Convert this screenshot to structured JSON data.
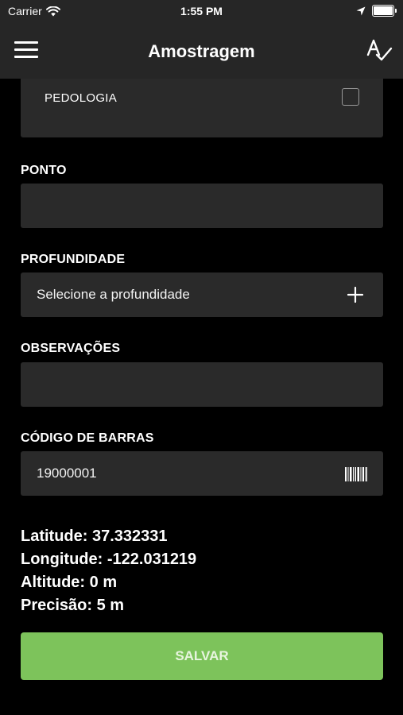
{
  "status_bar": {
    "carrier": "Carrier",
    "time": "1:55 PM"
  },
  "nav": {
    "title": "Amostragem",
    "menu_icon": "menu-icon",
    "right_icon": "spellcheck-icon"
  },
  "form": {
    "category": {
      "label": "PEDOLOGIA",
      "checked": false
    },
    "ponto": {
      "label": "PONTO",
      "value": ""
    },
    "profundidade": {
      "label": "PROFUNDIDADE",
      "placeholder": "Selecione a profundidade",
      "icon": "plus-icon"
    },
    "observacoes": {
      "label": "OBSERVAÇÕES",
      "value": ""
    },
    "codigo_barras": {
      "label": "CÓDIGO DE BARRAS",
      "value": "19000001",
      "icon": "barcode-icon"
    }
  },
  "location": {
    "latitude": "Latitude: 37.332331",
    "longitude": "Longitude: -122.031219",
    "altitude": "Altitude: 0 m",
    "precisao": "Precisão: 5 m"
  },
  "actions": {
    "save_label": "SALVAR"
  },
  "colors": {
    "background": "#000000",
    "bar": "#262626",
    "field": "#2a2a2a",
    "accent_green": "#7dc35b"
  }
}
